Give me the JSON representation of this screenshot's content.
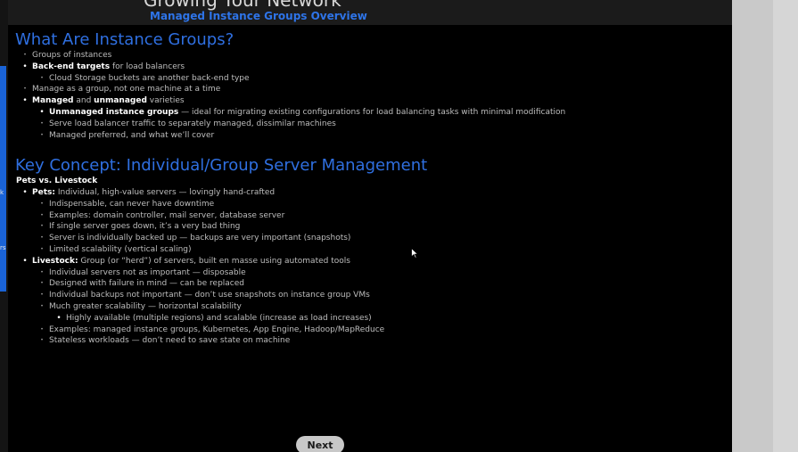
{
  "header": {
    "title": "Growing Your Network",
    "subtitle": "Managed Instance Groups Overview"
  },
  "sidebar_fragments": [
    "k",
    "rs"
  ],
  "sections": [
    {
      "title": "What Are Instance Groups?",
      "items": [
        {
          "level": 1,
          "bold": "",
          "text": "Groups of instances"
        },
        {
          "level": 1,
          "bold": "Back-end targets",
          "text": " for load balancers"
        },
        {
          "level": 2,
          "bold": "",
          "text": "Cloud Storage buckets are another back-end type"
        },
        {
          "level": 1,
          "bold": "",
          "text": "Manage as a group, not one machine at a time"
        },
        {
          "level": 1,
          "bold": "",
          "text": ""
        },
        {
          "level": 2,
          "bold": "Unmanaged instance groups",
          "text": " — ideal for migrating existing configurations for load balancing tasks with minimal modification"
        },
        {
          "level": 2,
          "bold": "",
          "text": "Serve load balancer traffic to separately managed, dissimilar machines"
        },
        {
          "level": 2,
          "bold": "",
          "text": "Managed preferred, and what we’ll cover"
        }
      ],
      "managed_line": {
        "bold1": "Managed",
        "mid": " and ",
        "bold2": "unmanaged",
        "end": " varieties"
      }
    },
    {
      "title": "Key Concept: Individual/Group Server Management",
      "label": "Pets vs. Livestock",
      "items": [
        {
          "level": 1,
          "bold": "Pets:",
          "text": " Individual, high-value servers — lovingly hand-crafted"
        },
        {
          "level": 2,
          "bold": "",
          "text": "Indispensable, can never have downtime"
        },
        {
          "level": 2,
          "bold": "",
          "text": "Examples: domain controller, mail server, database server"
        },
        {
          "level": 2,
          "bold": "",
          "text": "If single server goes down, it’s a very bad thing"
        },
        {
          "level": 2,
          "bold": "",
          "text": "Server is individually backed up — backups are very important (snapshots)"
        },
        {
          "level": 2,
          "bold": "",
          "text": "Limited scalability (vertical scaling)"
        },
        {
          "level": 1,
          "bold": "Livestock:",
          "text": " Group (or “herd”) of servers, built en masse using automated tools"
        },
        {
          "level": 2,
          "bold": "",
          "text": "Individual servers not as important — disposable"
        },
        {
          "level": 2,
          "bold": "",
          "text": "Designed with failure in mind — can be replaced"
        },
        {
          "level": 2,
          "bold": "",
          "text": "Individual backups not important — don’t use snapshots on instance group VMs"
        },
        {
          "level": 2,
          "bold": "",
          "text": "Much greater scalability — horizontal scalability"
        },
        {
          "level": 3,
          "bold": "",
          "text": "Highly available (multiple regions) and scalable (increase as load increases)"
        },
        {
          "level": 2,
          "bold": "",
          "text": "Examples: managed instance groups, Kubernetes, App Engine, Hadoop/MapReduce"
        },
        {
          "level": 2,
          "bold": "",
          "text": "Stateless workloads — don’t need to save state on machine"
        }
      ]
    }
  ],
  "footer": {
    "next_label": "Next"
  },
  "colors": {
    "accent": "#2f6fe0",
    "subtitle": "#2e74e8",
    "background": "#000000"
  }
}
